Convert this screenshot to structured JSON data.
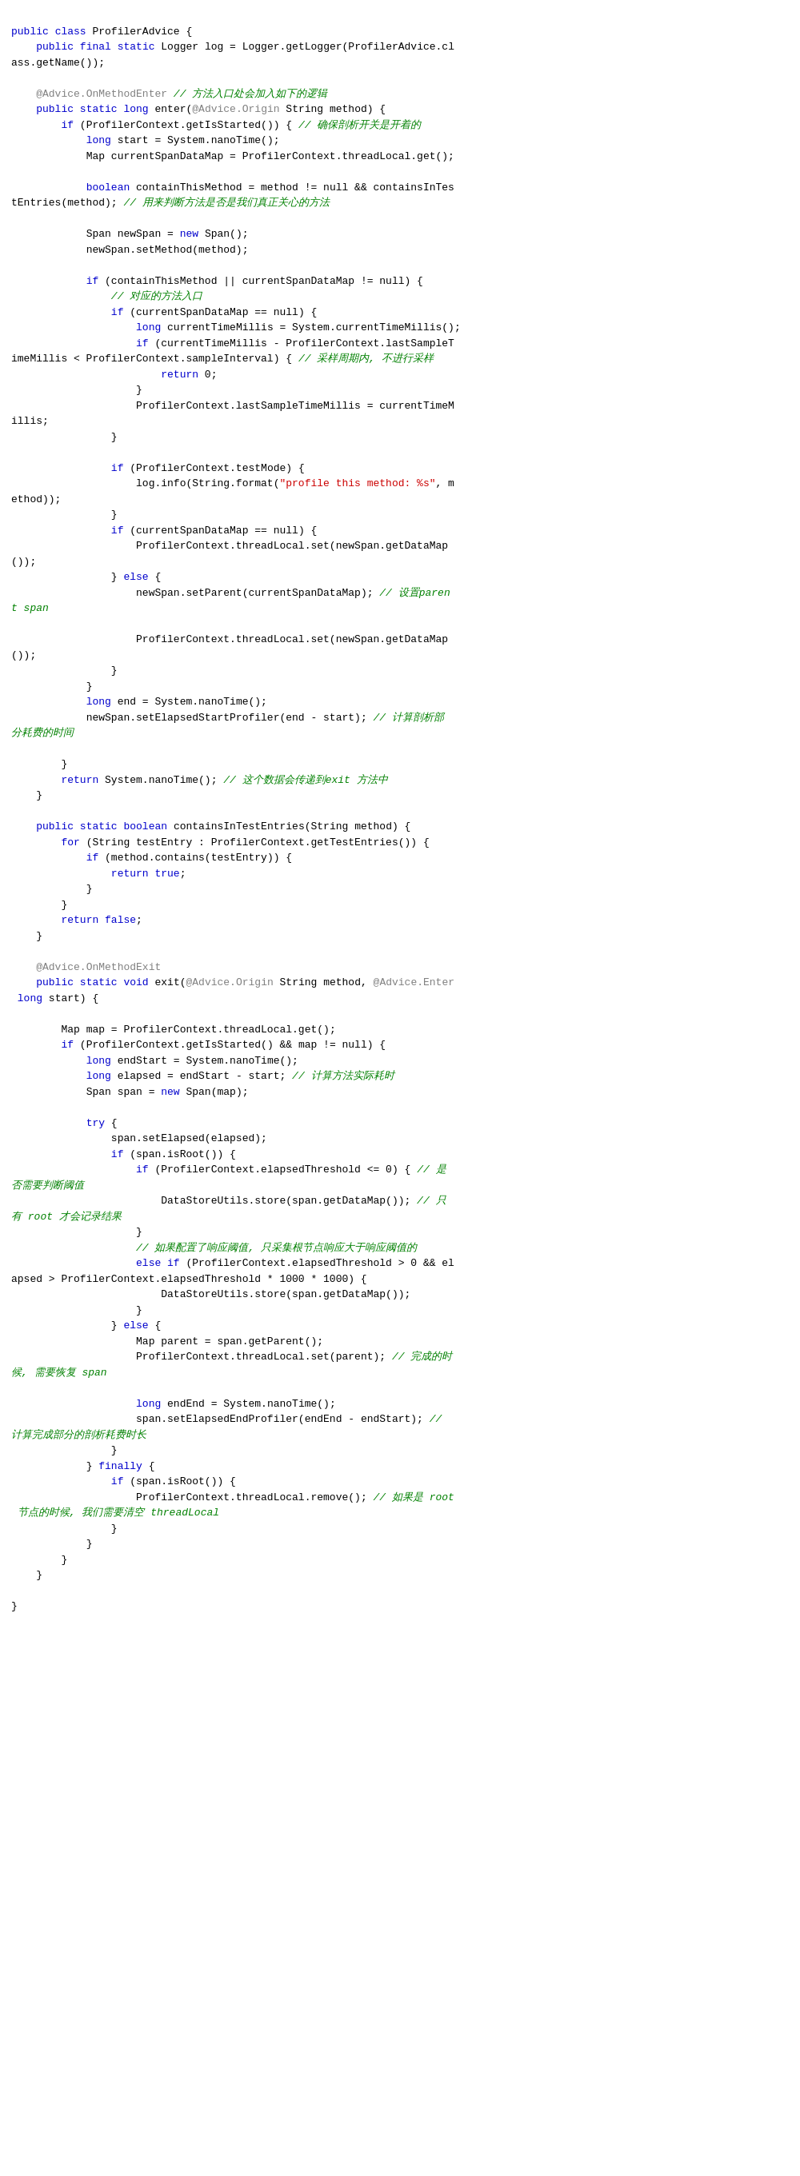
{
  "code": {
    "lines": []
  }
}
